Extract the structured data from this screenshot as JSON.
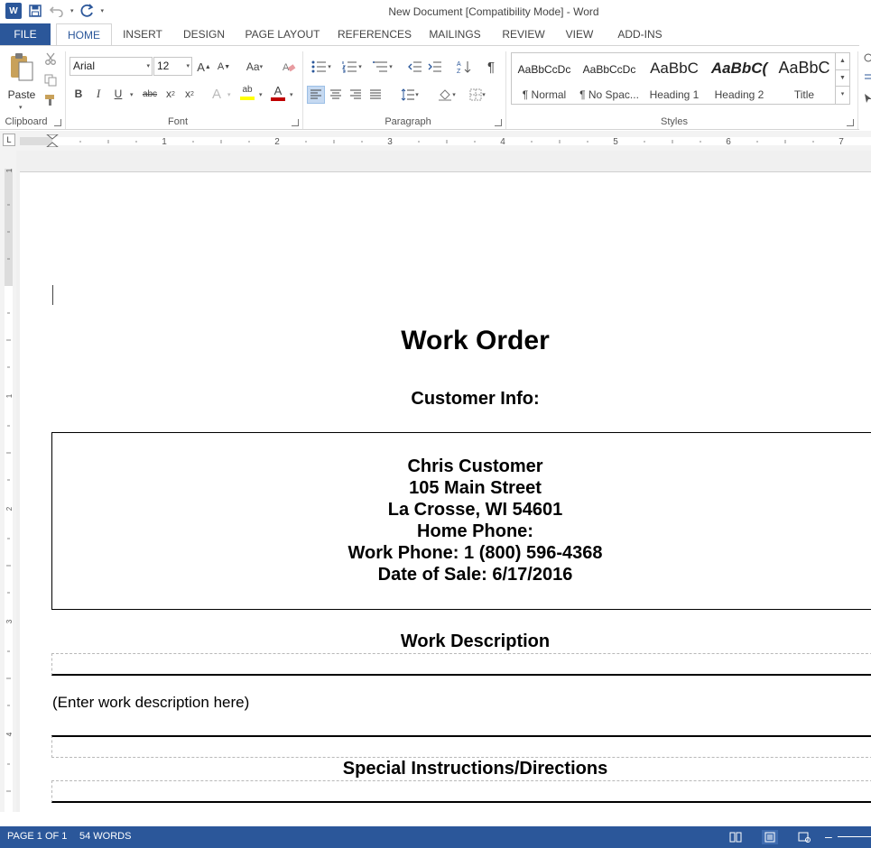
{
  "window": {
    "title": "New Document [Compatibility Mode] - Word",
    "app_icon_label": "W",
    "qat_customize": "▾"
  },
  "tabs": [
    {
      "label": "FILE"
    },
    {
      "label": "HOME"
    },
    {
      "label": "INSERT"
    },
    {
      "label": "DESIGN"
    },
    {
      "label": "PAGE LAYOUT"
    },
    {
      "label": "REFERENCES"
    },
    {
      "label": "MAILINGS"
    },
    {
      "label": "REVIEW"
    },
    {
      "label": "VIEW"
    },
    {
      "label": "ADD-INS"
    }
  ],
  "ribbon": {
    "clipboard": {
      "label": "Clipboard",
      "paste_label": "Paste"
    },
    "font": {
      "label": "Font",
      "font_name": "Arial",
      "font_size": "12",
      "grow": "A",
      "shrink": "A",
      "change_case": "Aa",
      "bold": "B",
      "italic": "I",
      "underline": "U",
      "strike": "abc",
      "subscript": "x",
      "superscript": "x",
      "sub_mark": "2",
      "super_mark": "2",
      "effects": "A",
      "highlight": "ab",
      "font_color": "A"
    },
    "paragraph": {
      "label": "Paragraph",
      "show_marks": "¶"
    },
    "styles": {
      "label": "Styles",
      "items": [
        {
          "sample": "AaBbCcDc",
          "name": "¶ Normal"
        },
        {
          "sample": "AaBbCcDc",
          "name": "¶ No Spac..."
        },
        {
          "sample": "AaBbC",
          "name": "Heading 1"
        },
        {
          "sample": "AaBbC(",
          "name": "Heading 2"
        },
        {
          "sample": "AaBbC",
          "name": "Title"
        }
      ]
    }
  },
  "ruler": {
    "tab_selector": "L",
    "h_numbers": [
      "1",
      "2",
      "3",
      "4",
      "5",
      "6",
      "7"
    ],
    "v_numbers": [
      "1",
      "1",
      "2",
      "3",
      "4"
    ]
  },
  "document": {
    "title": "Work Order",
    "customer_heading": "Customer Info:",
    "customer_lines": [
      "Chris Customer",
      "105 Main Street",
      "La Crosse, WI 54601",
      "Home Phone:",
      "Work Phone:  1 (800) 596-4368",
      "Date of Sale:  6/17/2016"
    ],
    "work_description_heading": "Work Description",
    "work_description_placeholder": "(Enter work description here)",
    "special_instructions_heading": "Special Instructions/Directions"
  },
  "status": {
    "page": "PAGE 1 OF 1",
    "words": "54 WORDS",
    "zoom_minus": "–"
  },
  "colors": {
    "accent": "#2b579a"
  }
}
